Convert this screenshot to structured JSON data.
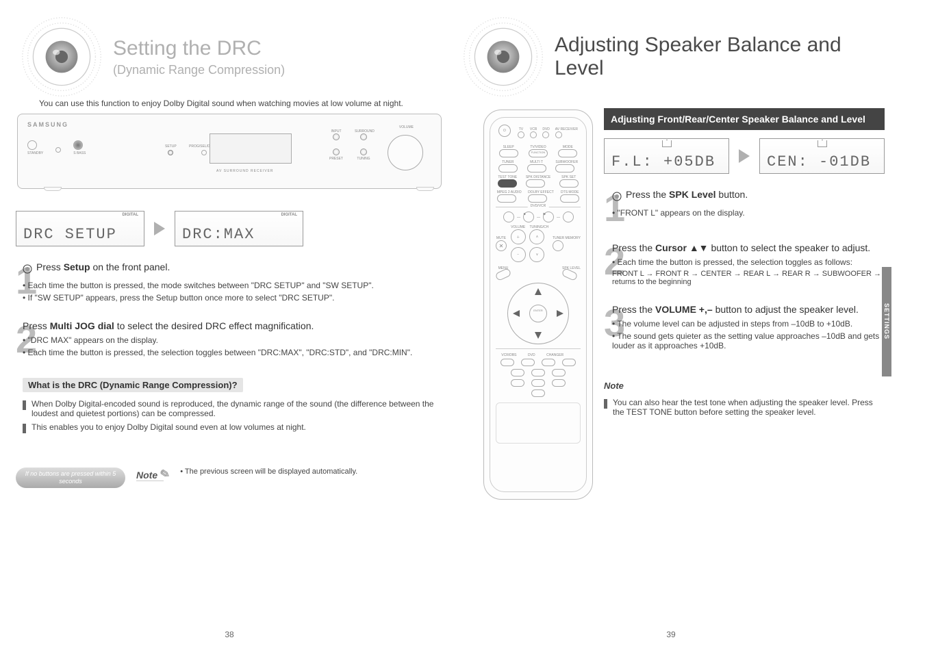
{
  "pageLeft": {
    "title_main": "Setting the DRC",
    "title_sub": "(Dynamic Range Compression)",
    "intro": "You can use this function to enjoy Dolby Digital sound when watching movies at low volume at night.",
    "headerbar": "",
    "vfd1": "DRC SETUP",
    "vfd1_flag": "DIGITAL",
    "vfd2": "DRC:MAX",
    "vfd2_flag": "DIGITAL",
    "step1_no": "1",
    "step1_main_a": "Press ",
    "step1_main_b": "Setup",
    "step1_main_c": " on the front panel.",
    "step1_line1": "• Each time the button is pressed, the mode switches between \"DRC SETUP\" and \"SW SETUP\".",
    "step1_line2": "• If \"SW SETUP\" appears, press the Setup button once more to select \"DRC SETUP\".",
    "step2_no": "2",
    "step2_main_a": "Press ",
    "step2_main_b": "Multi JOG dial ",
    "step2_main_c": "to select the desired DRC effect magnification.",
    "step2_line1": "• \"DRC MAX\" appears on the display.",
    "step2_line2": "• Each time the button is pressed, the selection toggles between \"DRC:MAX\", \"DRC:STD\", and \"DRC:MIN\".",
    "highlight": "What is the DRC (Dynamic Range Compression)?",
    "hl_line1": "When Dolby Digital-encoded sound is reproduced, the dynamic range of the sound (the difference between the loudest and quietest portions) can be compressed.",
    "hl_line2": "This enables you to enjoy Dolby Digital sound even at low volumes at night.",
    "note_pill": "If no buttons are pressed within 5 seconds",
    "note_label": "Note",
    "note_text": "• The previous screen will be displayed automatically.",
    "pagenum": "38"
  },
  "pageRight": {
    "title_main": "Adjusting Speaker Balance and Level",
    "headerbar": "Adjusting Front/Rear/Center Speaker Balance and Level",
    "vfd1": "F.L: +05DB",
    "vfd2": "CEN: -01DB",
    "step1_no": "1",
    "step1_main_a": "Press the ",
    "step1_main_b": "SPK Level",
    "step1_main_c": " button.",
    "step1_line1": "• \"FRONT L\" appears on the display.",
    "step2_no": "2",
    "step2_main_a": "Press the ",
    "step2_main_b_cursor": "Cursor ",
    "step2_arrows": "▲▼",
    "step2_main_c": " button to select the speaker to adjust.",
    "step2_line1": "• Each time the button is pressed, the selection toggles as follows:",
    "step2_line2": "FRONT L → FRONT R → CENTER → REAR L → REAR R → SUBWOOFER → returns to the beginning",
    "step3_no": "3",
    "step3_main_a": "Press the ",
    "step3_main_b": "VOLUME +,–",
    "step3_main_c": " button to adjust the speaker level.",
    "step3_line1": "• The volume level can be adjusted in steps from –10dB to +10dB.",
    "step3_line2": "• The sound gets quieter as the setting value approaches –10dB and gets louder as it approaches +10dB.",
    "note_title": "Note",
    "note_line1": "You can also hear the test tone when adjusting the speaker level. Press the TEST TONE button before setting the speaker level.",
    "pagenum": "39",
    "side_tab": "SETTINGS"
  },
  "remote": {
    "top_labels": [
      "TV",
      "VCR",
      "DVD",
      "AV RECEIVER"
    ],
    "row1": [
      "SLEEP",
      "TV/VIDEO",
      "MODE"
    ],
    "func_label": "FUNCTION",
    "row2": [
      "TUNER",
      "MULTI T",
      "SUBWOOFER"
    ],
    "row3": [
      "TEST TONE",
      "SPK DISTANCE",
      "SPK SET"
    ],
    "row4": [
      "MPEG 2 AUDIO",
      "DOLBY EFFECT",
      "DTS MODE"
    ],
    "dvd_label": "DVD/VCR",
    "vol_label": "VOLUME",
    "tune_label": "TUNING/CH",
    "mute_label": "MUTE",
    "tmem_label": "TUNER MEMORY",
    "menu_label": "MENU",
    "spklvl_label": "SPK LEVEL",
    "enter_label": "ENTER",
    "num_row_tops": [
      "VCR/DBS",
      "DVD",
      "CHANGER"
    ]
  },
  "receiver": {
    "brand": "SAMSUNG",
    "btns": [
      "STANDBY",
      "",
      "S BASS"
    ],
    "setup": "SETUP",
    "sel": "PROG/SEL/DRECT",
    "sub": "AV SURROUND RECEIVER",
    "knobs": [
      "INPUT",
      "SURROUND",
      "",
      "PRESET"
    ],
    "vol": "VOLUME",
    "tune": "TUNING"
  }
}
